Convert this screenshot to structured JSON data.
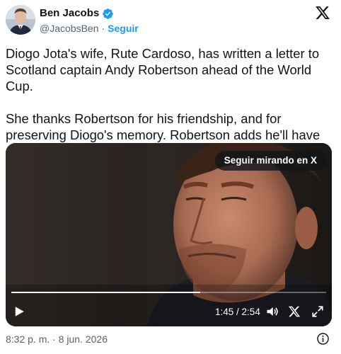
{
  "author": {
    "display_name": "Ben Jacobs",
    "handle": "@JacobsBen",
    "separator": "·",
    "follow_label": "Seguir",
    "verified": true,
    "verified_color": "#1d9bf0"
  },
  "tweet": {
    "paragraph_1": "Diogo Jota's wife, Rute Cardoso, has written a letter to\nScotland captain Andy Robertson ahead of the World Cup.",
    "paragraph_2": "She thanks Robertson for his friendship, and for\npreserving Diogo's memory. Robertson adds he'll have\nJota at the forefront of his mind.🙏"
  },
  "video": {
    "continue_label": "Seguir mirando en X",
    "current_time": "1:45",
    "duration": "2:54",
    "time_separator": " / ",
    "progress_fraction": 0.6
  },
  "footer": {
    "timestamp": "8:32 p. m. · 8 jun. 2026"
  },
  "icons": {
    "brand": "x-logo-icon",
    "verified": "verified-badge-icon",
    "play": "play-icon",
    "volume": "volume-icon",
    "fullscreen": "fullscreen-icon",
    "info": "info-icon"
  },
  "colors": {
    "text": "#0f1419",
    "secondary": "#536471",
    "link": "#1d9bf0"
  }
}
